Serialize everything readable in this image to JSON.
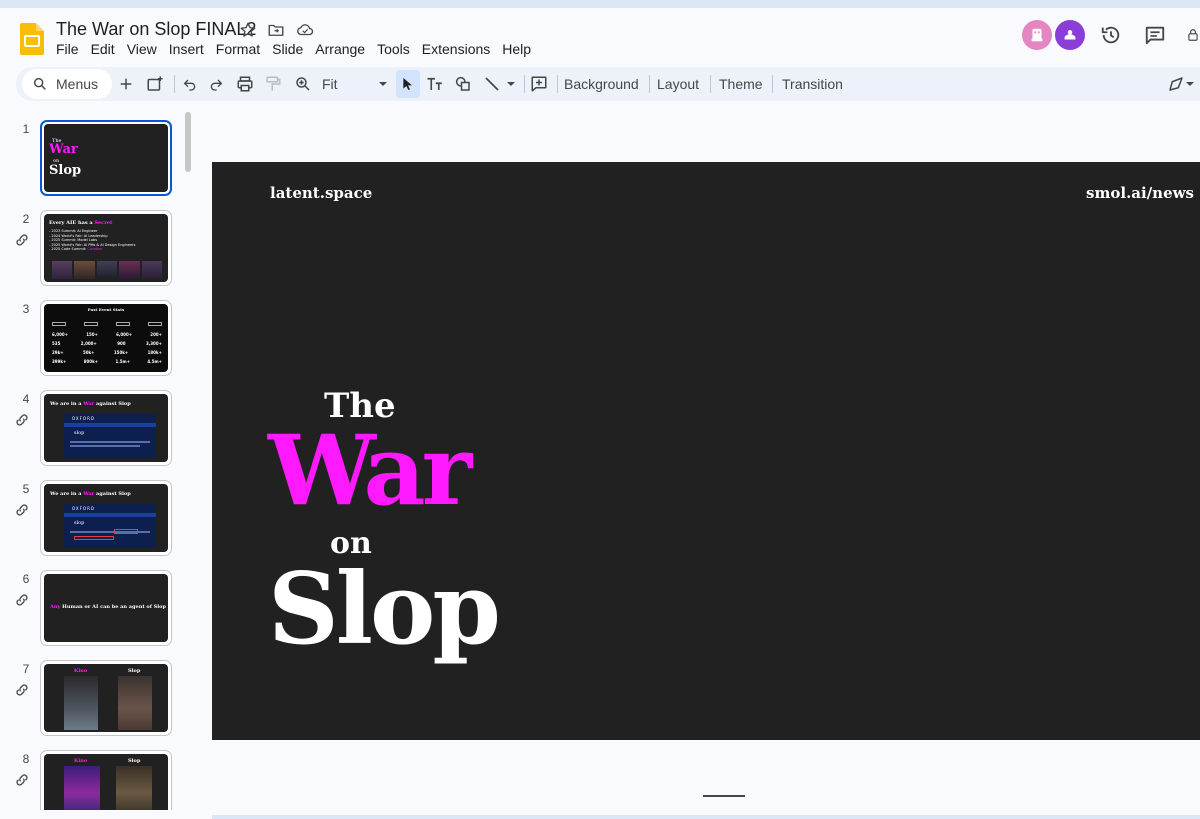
{
  "document": {
    "title": "The War on Slop FINAL2"
  },
  "menubar": [
    "File",
    "Edit",
    "View",
    "Insert",
    "Format",
    "Slide",
    "Arrange",
    "Tools",
    "Extensions",
    "Help"
  ],
  "toolbar": {
    "menus_label": "Menus",
    "zoom_label": "Fit",
    "background_label": "Background",
    "layout_label": "Layout",
    "theme_label": "Theme",
    "transition_label": "Transition"
  },
  "slide": {
    "top_left": "latent.space",
    "top_right": "smol.ai/news",
    "line1": "The",
    "line2": "War",
    "line3": "on",
    "line4": "Slop"
  },
  "thumbnails": [
    {
      "number": "1",
      "title": "The War on Slop",
      "linked": false,
      "selected": true
    },
    {
      "number": "2",
      "title": "Every AIE has a Secret",
      "linked": true,
      "selected": false
    },
    {
      "number": "3",
      "title": "Past Event Stats",
      "linked": false,
      "selected": false
    },
    {
      "number": "4",
      "title": "We are in a War against Slop",
      "linked": true,
      "selected": false
    },
    {
      "number": "5",
      "title": "We are in a War against Slop",
      "linked": true,
      "selected": false
    },
    {
      "number": "6",
      "title": "Any Human or AI can be an agent of Slop",
      "linked": true,
      "selected": false
    },
    {
      "number": "7",
      "title": "Kino Slop",
      "linked": true,
      "selected": false
    },
    {
      "number": "8",
      "title": "Kino Slop",
      "linked": true,
      "selected": false
    }
  ],
  "thumb_text": {
    "t1_the": "The",
    "t1_war": "War",
    "t1_on": "on",
    "t1_slop": "Slop",
    "t2_title_a": "Every AIE has a ",
    "t2_title_b": "Secret",
    "t2_bullets": [
      "- 2023 Summit: AI Engineer",
      "- 2024 World's Fair: AI Leadership",
      "- 2025 Summit: Model Labs",
      "- 2025 World's Fair: AI PMs & AI Design Engineers",
      "- 2025 Code Summit: "
    ],
    "t2_last_pink": "Curation",
    "t3_title": "Past Event Stats",
    "t3_stats": [
      [
        "6,000+",
        "150+",
        "6,000+",
        "200+"
      ],
      [
        "535",
        "2,000+",
        "900",
        "3,300+"
      ],
      [
        "29k+",
        "50k+",
        "150k+",
        "180k+"
      ],
      [
        "399k+",
        "800k+",
        "1.5m+",
        "4.5m+"
      ]
    ],
    "t45_title_a": "We are in a ",
    "t45_title_war": "War",
    "t45_title_b": " against Slop",
    "t45_oxford": "OXFORD",
    "t45_slop": "slop",
    "t6_any": "Any",
    "t6_rest": " Human or AI can be an agent of Slop",
    "t78_kino": "Kino",
    "t78_slop": "Slop"
  },
  "colors": {
    "accent_pink": "#ff19ff",
    "slide_bg": "#212121",
    "selection_blue": "#0b57d0",
    "toolbar_bg": "#edf2fa",
    "avatar1": "#e586c3",
    "avatar2": "#8b3dd8"
  },
  "icons": {
    "app": "google-slides-icon",
    "star": "star-icon",
    "move": "move-to-folder-icon",
    "cloud": "cloud-saved-icon",
    "history": "version-history-icon",
    "comments": "comments-icon"
  }
}
